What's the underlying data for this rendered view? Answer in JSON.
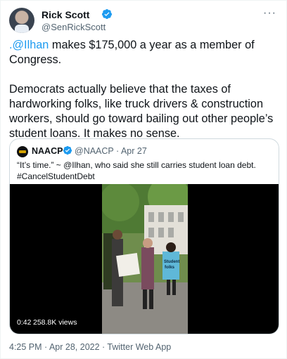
{
  "author": {
    "display_name": "Rick Scott",
    "handle": "@SenRickScott",
    "avatar_icon": "profile-photo",
    "verified_icon": "verified-badge-icon"
  },
  "menu": {
    "more_label": "···"
  },
  "tweet": {
    "p1_mention": ".@Ilhan",
    "p1_rest": " makes $175,000 a year as a member of Congress.",
    "p2": "Democrats actually believe that the taxes of hardworking folks, like truck drivers & construction workers, should go toward bailing out other people’s student loans. It makes no sense."
  },
  "quoted": {
    "display_name": "NAACP",
    "meta": "@NAACP · Apr 27",
    "text_line1": "“It’s time.” ~ @Ilhan, who said she still carries student loan debt.",
    "text_line2": "#CancelStudentDebt",
    "video": {
      "duration": "0:42",
      "views": "258.8K views",
      "sign_text": "Student\nfolks"
    }
  },
  "footer": {
    "meta": "4:25 PM · Apr 28, 2022 · Twitter Web App"
  },
  "colors": {
    "link": "#1d9bf0",
    "secondary": "#536471",
    "border": "#cfd9de"
  }
}
